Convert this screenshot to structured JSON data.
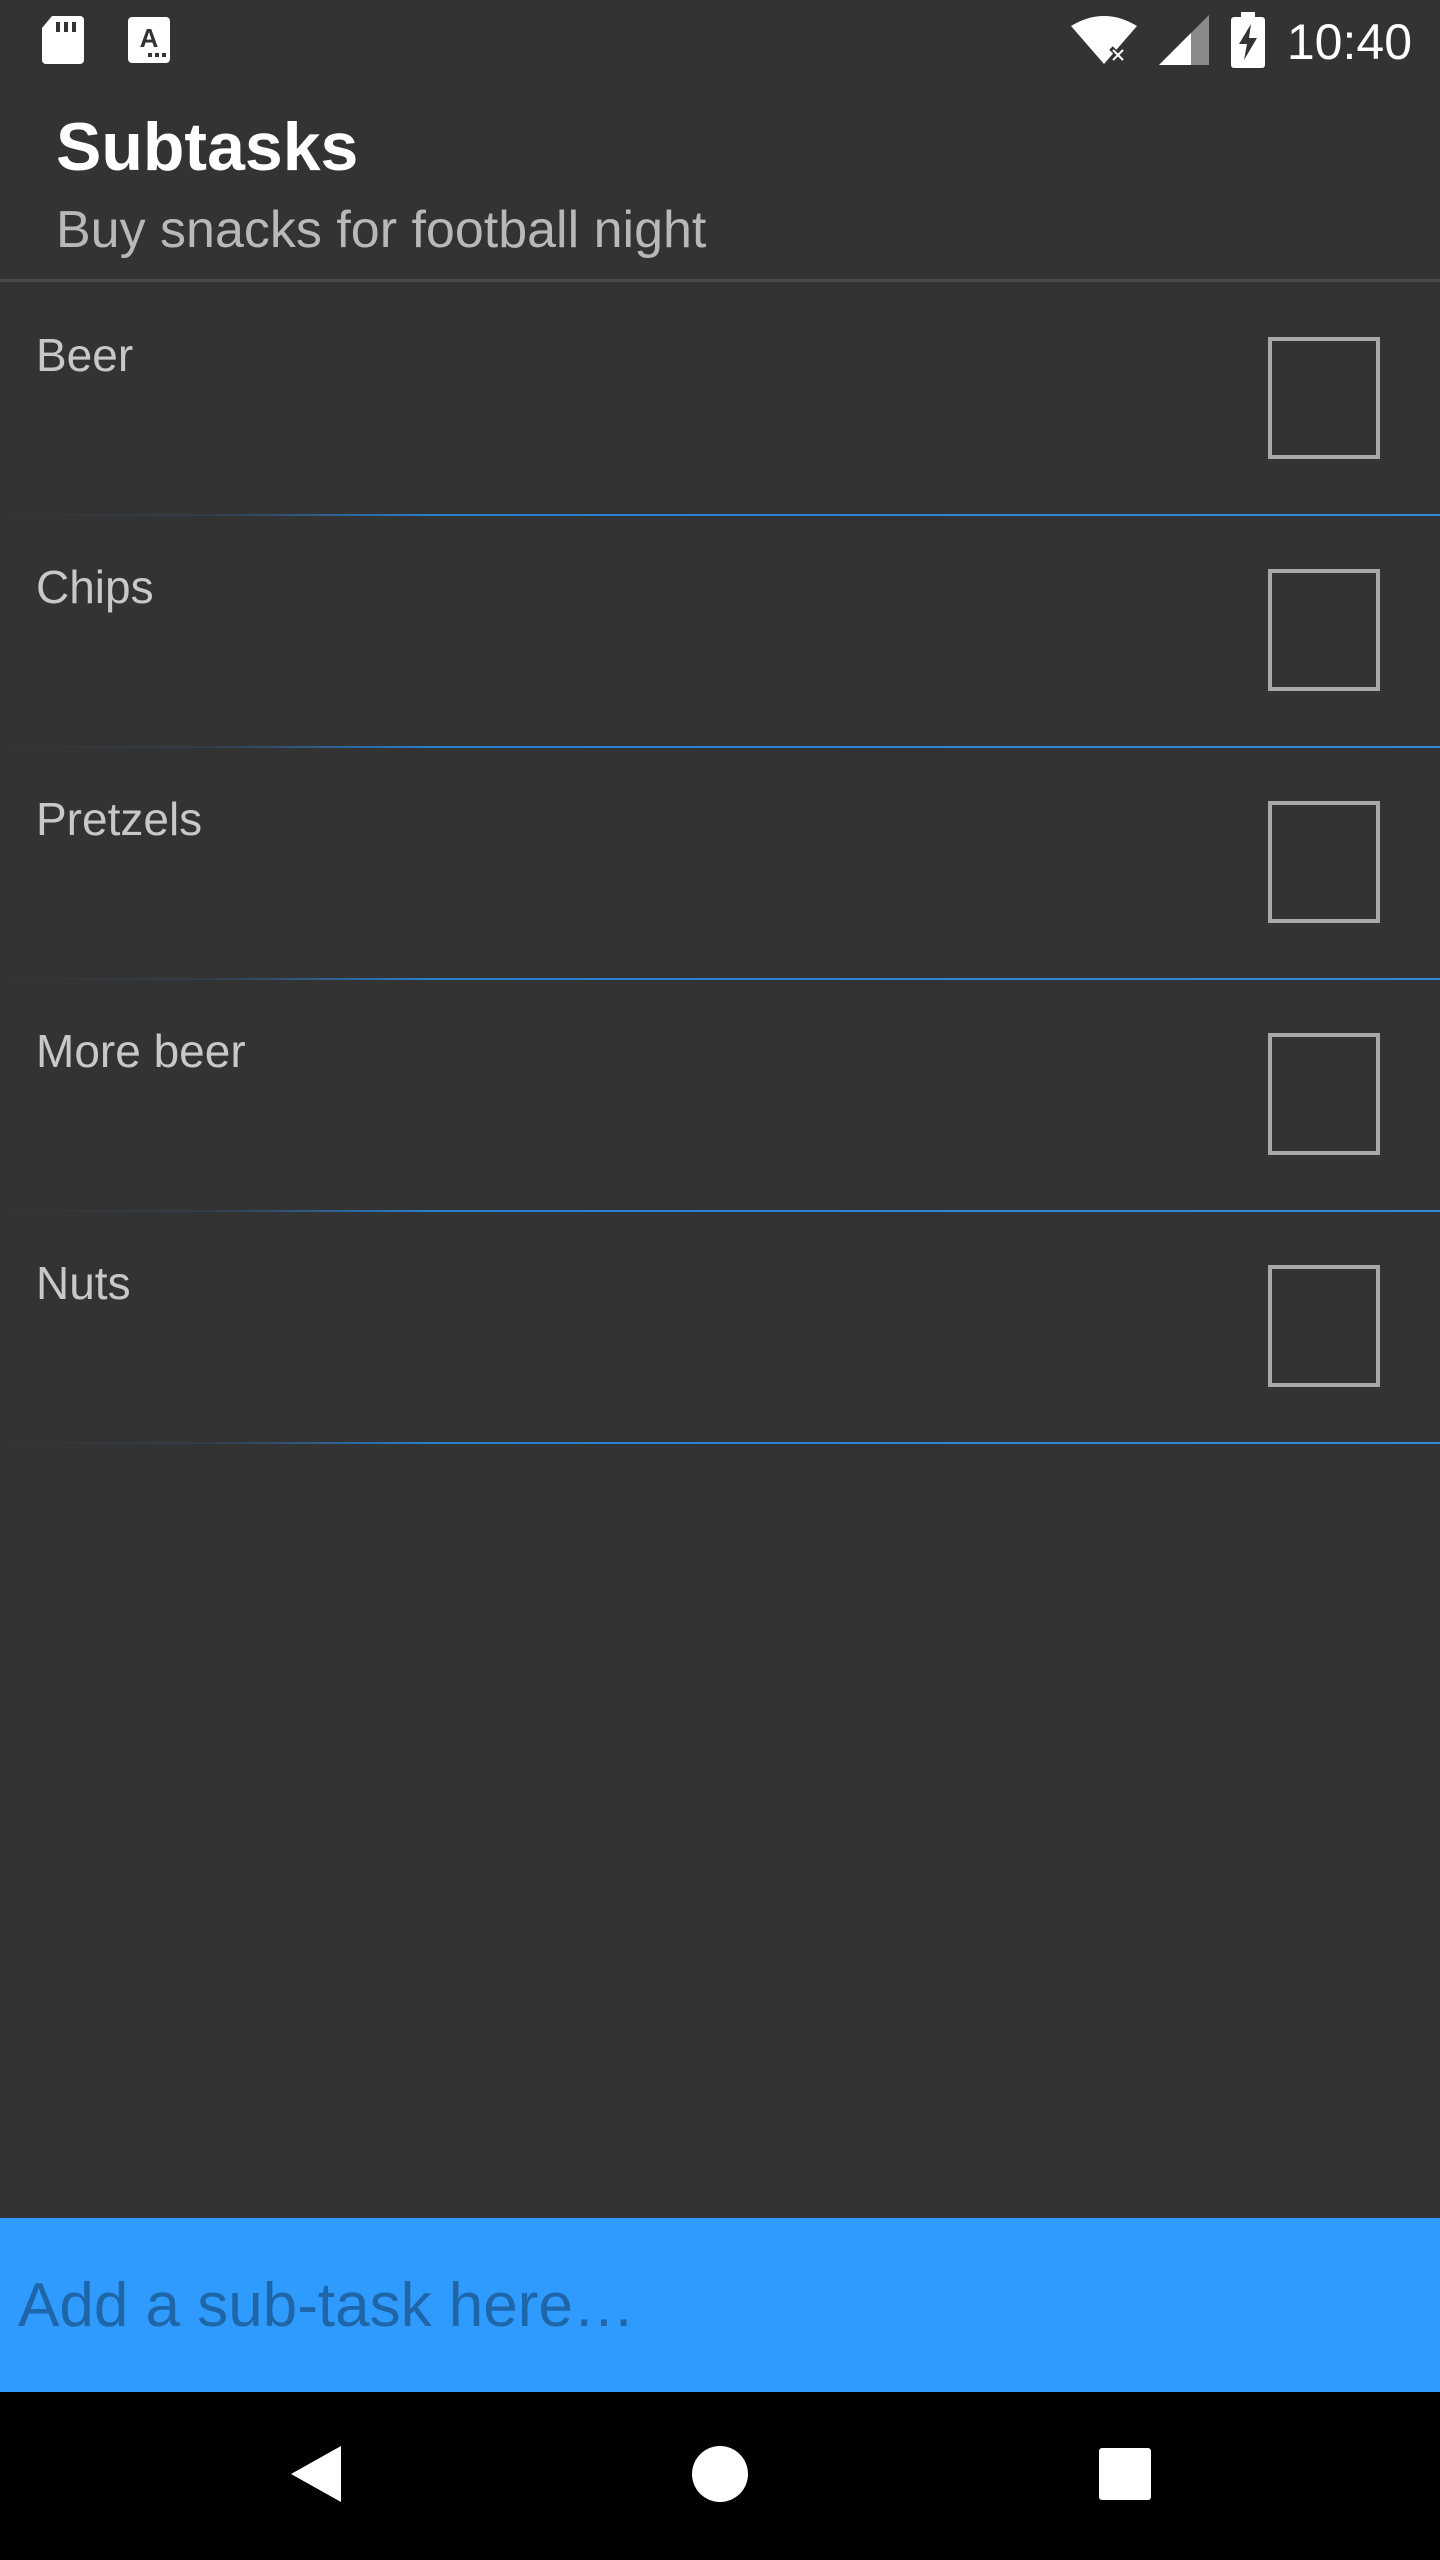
{
  "status_bar": {
    "time": "10:40",
    "icons": [
      "sd-card-icon",
      "app-notification-icon",
      "wifi-icon",
      "signal-icon",
      "battery-charging-icon"
    ]
  },
  "header": {
    "title": "Subtasks",
    "subtitle": "Buy snacks for football night"
  },
  "subtasks": [
    {
      "label": "Beer",
      "checked": false
    },
    {
      "label": "Chips",
      "checked": false
    },
    {
      "label": "Pretzels",
      "checked": false
    },
    {
      "label": "More beer",
      "checked": false
    },
    {
      "label": "Nuts",
      "checked": false
    }
  ],
  "add_bar": {
    "placeholder": "Add a sub-task here…"
  },
  "nav": {
    "icons": [
      "back-icon",
      "home-icon",
      "recents-icon"
    ]
  },
  "colors": {
    "background": "#333333",
    "accent": "#2f9bff",
    "divider": "#2f8ae0"
  }
}
